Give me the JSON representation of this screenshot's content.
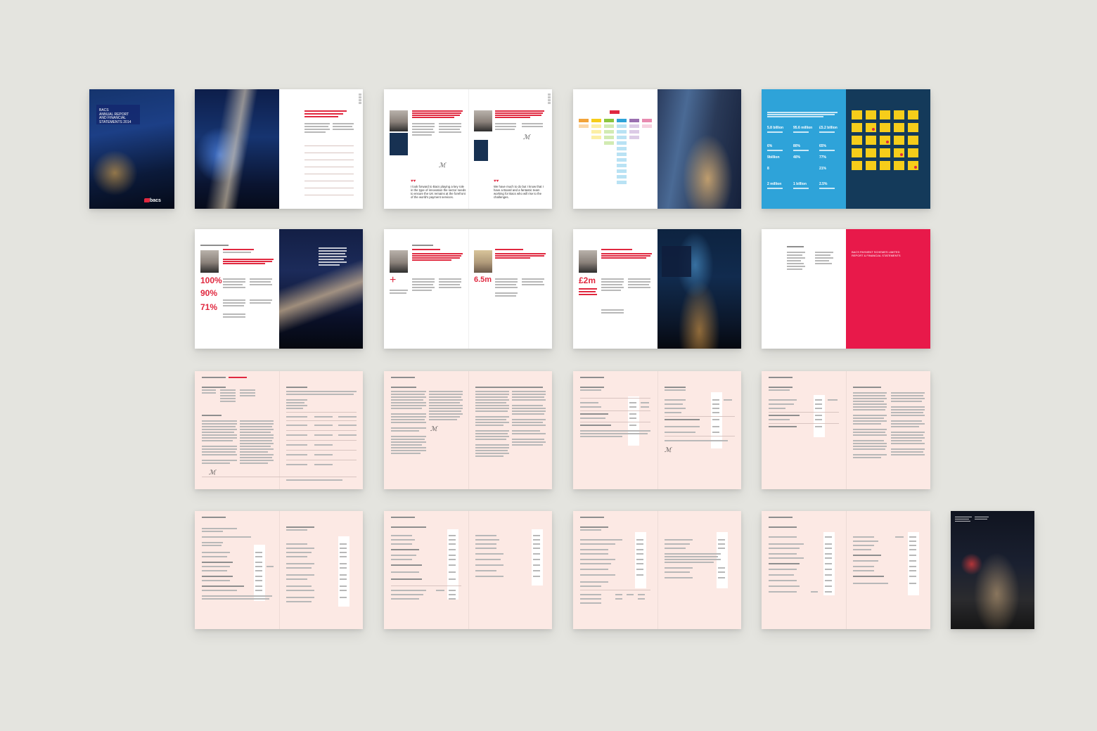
{
  "cover": {
    "title_line1": "BACS",
    "title_line2": "ANNUAL REPORT",
    "title_line3": "AND FINANCIAL",
    "title_line4": "STATEMENTS 2014",
    "logo": "bacs"
  },
  "spread_quotes": {
    "quote_left": "I look forward to Bacs playing a key role in the type of innovation the sector needs to ensure the UK remains at the forefront of the world's payment services.",
    "quote_right": "We have much to do but I know that I have a Board and a fantastic team working for Bacs who will rise to the challenges."
  },
  "stats_panel": {
    "stats": [
      "5.8 billion",
      "95.6 million",
      "£5.2 billion",
      "6%",
      "80%",
      "65%",
      "9billion",
      "40%",
      "77%",
      "8",
      "",
      "21%",
      "2 million",
      "1 billion",
      "2.5%"
    ]
  },
  "spread_ops": {
    "stat1": "100%",
    "stat2": "90%",
    "stat3": "71%"
  },
  "spread_mid": {
    "stat_plus": "+",
    "stat_65": "6.5m"
  },
  "spread_2m": {
    "stat": "£2m"
  },
  "red_panel": {
    "line1": "BACS PAYMENT SCHEMES LIMITED",
    "line2": "REPORT & FINANCIAL STATEMENTS"
  },
  "colors": {
    "background": "#e4e4df",
    "brand_red": "#e0283f",
    "panel_red": "#e8194a",
    "stats_blue": "#2ea3d9",
    "stats_navy": "#143a5a",
    "sticky_yellow": "#f6cd1a",
    "financial_pink": "#fce9e4"
  }
}
